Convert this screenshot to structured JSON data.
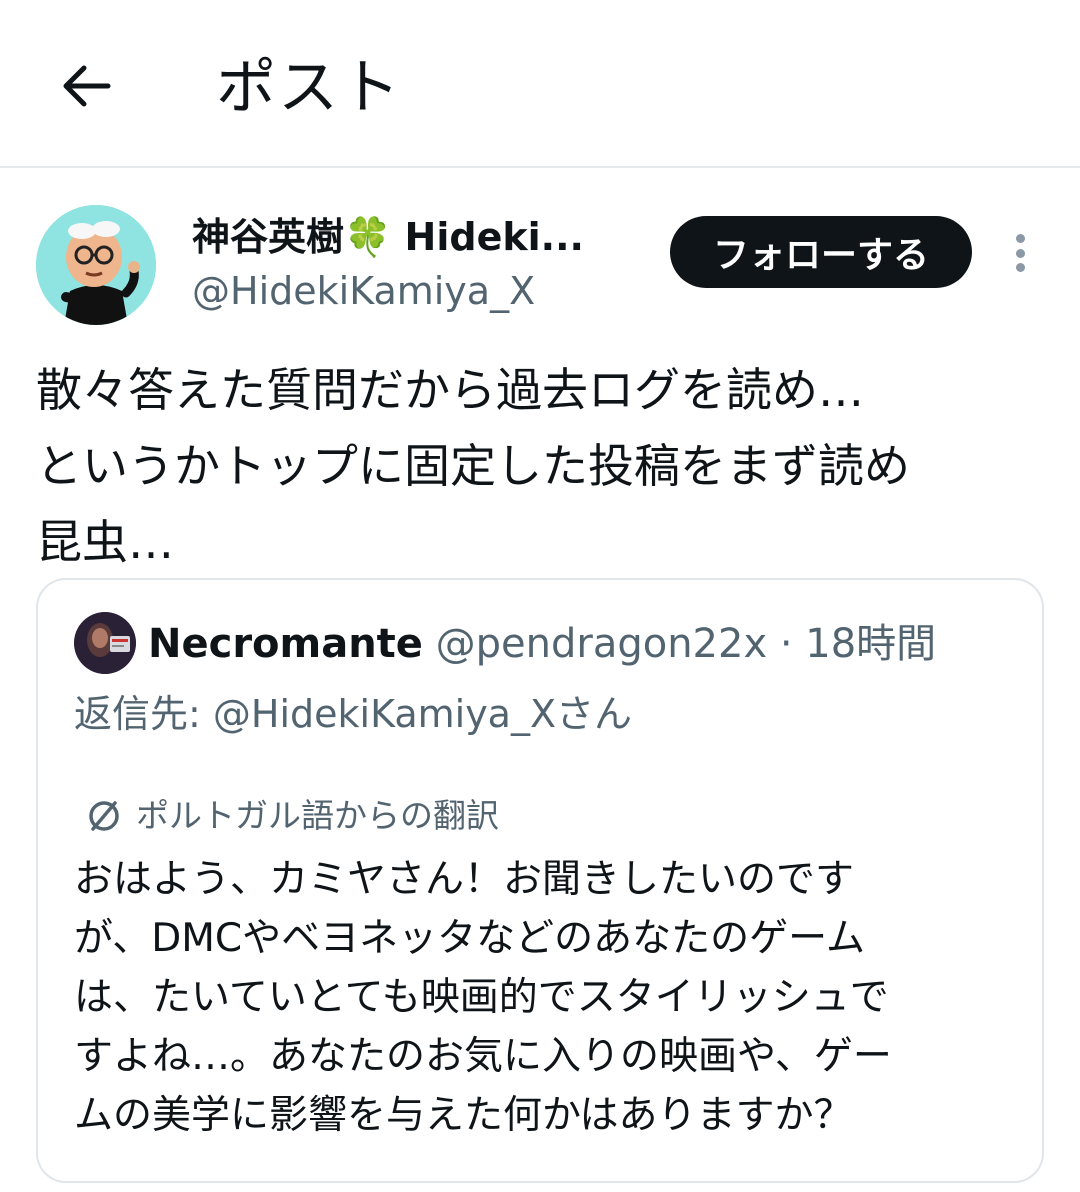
{
  "header": {
    "title": "ポスト",
    "back_icon": "arrow-left-icon"
  },
  "author": {
    "display_name": "神谷英樹🍀 Hideki...",
    "handle": "@HidekiKamiya_X",
    "follow_label": "フォローする",
    "more_icon": "more-vertical-icon"
  },
  "post": {
    "lines": [
      "散々答えた質問だから過去ログを読め…",
      "というかトップに固定した投稿をまず読め",
      "昆虫…"
    ]
  },
  "quote": {
    "name": "Necromante",
    "handle": "@pendragon22x",
    "separator": "·",
    "time": "18時間",
    "reply_to": "返信先: @HidekiKamiya_Xさん",
    "translation_label": "ポルトガル語からの翻訳",
    "translation_icon": "translate-icon",
    "lines": [
      "おはよう、カミヤさん！お聞きしたいのです",
      "が、DMCやベヨネッタなどのあなたのゲーム",
      "は、たいていとても映画的でスタイリッシュで",
      "すよね…。あなたのお気に入りの映画や、ゲー",
      "ムの美学に影響を与えた何かはありますか？"
    ]
  },
  "colors": {
    "text_primary": "#0f1419",
    "text_secondary": "#536471",
    "border": "#e1e6ea",
    "follow_bg": "#0f1419",
    "avatar_bg": "#8fe3e0"
  }
}
